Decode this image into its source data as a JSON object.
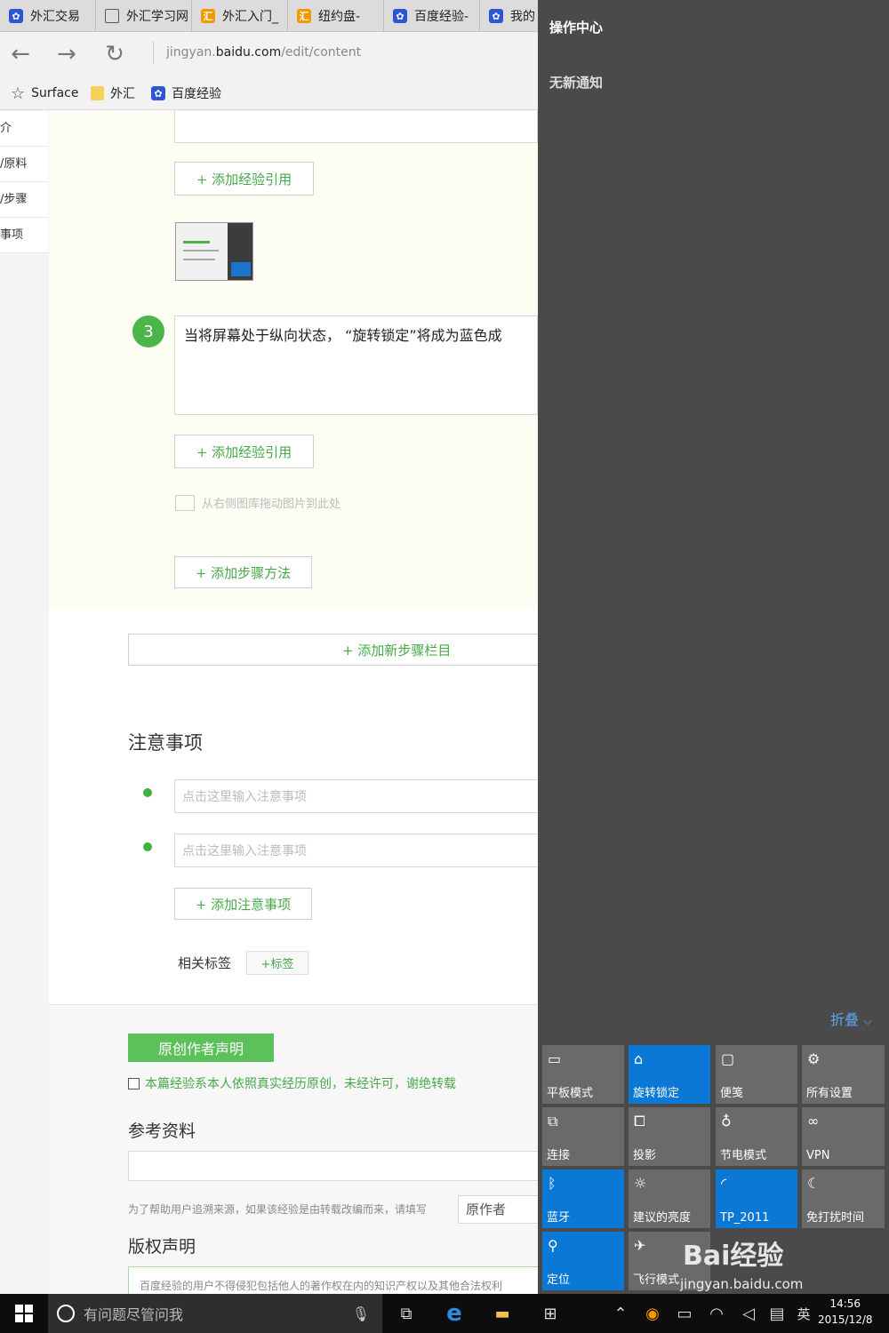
{
  "browser": {
    "tabs": [
      {
        "label": "外汇交易",
        "icon": "baidu-paw-icon"
      },
      {
        "label": "外汇学习网",
        "icon": "page-icon"
      },
      {
        "label": "外汇入门_",
        "icon": "hui-icon"
      },
      {
        "label": "纽约盘-",
        "icon": "hui-icon"
      },
      {
        "label": "百度经验-",
        "icon": "baidu-paw-icon"
      },
      {
        "label": "我的",
        "icon": "baidu-paw-icon"
      }
    ],
    "url_prefix": "jingyan.",
    "url_domain": "baidu.com",
    "url_path": "/edit/content",
    "favorites": [
      "Surface",
      "外汇",
      "百度经验"
    ]
  },
  "sidenav": {
    "items": [
      "介",
      "/原料",
      "/步骤",
      "事项"
    ]
  },
  "editor": {
    "add_reference": "+ 添加经验引用",
    "step3_number": "3",
    "step3_text": "当将屏幕处于纵向状态，  “旋转锁定”将成为蓝色成",
    "drag_hint": "从右侧图库拖动图片到此处",
    "add_method": "+ 添加步骤方法",
    "add_section": "+ 添加新步骤栏目"
  },
  "notes": {
    "title": "注意事项",
    "placeholder": "点击这里输入注意事项",
    "add_note": "+ 添加注意事项",
    "tags_label": "相关标签",
    "tag_button": "+标签"
  },
  "original": {
    "button": "原创作者声明",
    "declaration": "本篇经验系本人依照真实经历原创，未经许可，谢绝转载"
  },
  "reference": {
    "title": "参考资料",
    "hint": "为了帮助用户追溯来源，如果该经验是由转载改编而来，请填写",
    "author_field": "原作者"
  },
  "copyright": {
    "title": "版权声明",
    "text": "百度经验的用户不得侵犯包括他人的著作权在内的知识产权以及其他合法权利"
  },
  "action_center": {
    "title": "操作中心",
    "no_notifications": "无新通知",
    "collapse": "折叠",
    "tiles": [
      {
        "label": "平板模式",
        "icon": "tablet-mode-icon",
        "on": false
      },
      {
        "label": "旋转锁定",
        "icon": "rotation-lock-icon",
        "on": true
      },
      {
        "label": "便笺",
        "icon": "note-icon",
        "on": false
      },
      {
        "label": "所有设置",
        "icon": "gear-icon",
        "on": false
      },
      {
        "label": "连接",
        "icon": "connect-icon",
        "on": false
      },
      {
        "label": "投影",
        "icon": "project-icon",
        "on": false
      },
      {
        "label": "节电模式",
        "icon": "battery-saver-icon",
        "on": false
      },
      {
        "label": "VPN",
        "icon": "vpn-icon",
        "on": false
      },
      {
        "label": "蓝牙",
        "icon": "bluetooth-icon",
        "on": true
      },
      {
        "label": "建议的亮度",
        "icon": "brightness-icon",
        "on": false
      },
      {
        "label": "TP_2011",
        "icon": "wifi-icon",
        "on": true
      },
      {
        "label": "免打扰时间",
        "icon": "quiet-hours-icon",
        "on": false
      },
      {
        "label": "定位",
        "icon": "location-icon",
        "on": true
      },
      {
        "label": "飞行模式",
        "icon": "airplane-icon",
        "on": false
      }
    ]
  },
  "taskbar": {
    "search_placeholder": "有问题尽管问我",
    "ime": "英",
    "time": "14:56",
    "date": "2015/12/8"
  },
  "watermark": {
    "logo": "Bai经验",
    "site": "jingyan.baidu.com"
  },
  "colors": {
    "accent_blue": "#0a78d4",
    "green": "#4bb54a",
    "action_center_bg": "#4a4a4a"
  }
}
